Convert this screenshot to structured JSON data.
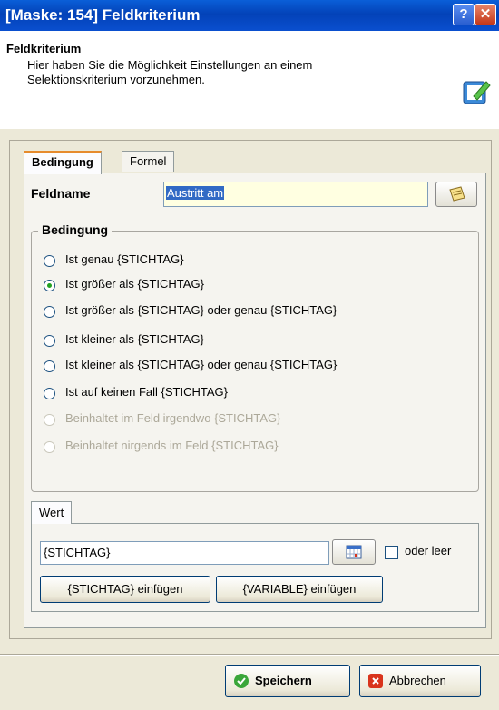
{
  "window": {
    "title": "[Maske: 154] Feldkriterium",
    "help_glyph": "?",
    "close_glyph": "✕"
  },
  "header": {
    "title": "Feldkriterium",
    "description": "Hier haben Sie die Möglichkeit Einstellungen an einem Selektionskriterium vorzunehmen."
  },
  "tabs": [
    "Bedingung",
    "Formel"
  ],
  "feldname": {
    "label": "Feldname",
    "value": "Austritt am"
  },
  "bedingung": {
    "label": "Bedingung",
    "options": [
      {
        "label": "Ist genau {STICHTAG}",
        "checked": false,
        "enabled": true
      },
      {
        "label": "Ist größer als {STICHTAG}",
        "checked": true,
        "enabled": true
      },
      {
        "label": "Ist größer als {STICHTAG} oder genau {STICHTAG}",
        "checked": false,
        "enabled": true
      },
      {
        "label": "Ist kleiner als {STICHTAG}",
        "checked": false,
        "enabled": true
      },
      {
        "label": "Ist kleiner als {STICHTAG} oder genau {STICHTAG}",
        "checked": false,
        "enabled": true
      },
      {
        "label": "Ist auf keinen Fall {STICHTAG}",
        "checked": false,
        "enabled": true
      },
      {
        "label": "Beinhaltet im Feld irgendwo {STICHTAG}",
        "checked": false,
        "enabled": false
      },
      {
        "label": "Beinhaltet nirgends im Feld {STICHTAG}",
        "checked": false,
        "enabled": false
      }
    ]
  },
  "wert": {
    "tab_label": "Wert",
    "value": "{STICHTAG}",
    "oder_leer_label": "oder leer",
    "oder_leer_checked": false,
    "insert_stichtag_label": "{STICHTAG} einfügen",
    "insert_variable_label": "{VARIABLE} einfügen"
  },
  "footer": {
    "save_label": "Speichern",
    "cancel_label": "Abbrechen"
  },
  "colors": {
    "titlebar": "#0342b8",
    "save_icon": "#3aa63a",
    "cancel_icon": "#d9341c"
  }
}
